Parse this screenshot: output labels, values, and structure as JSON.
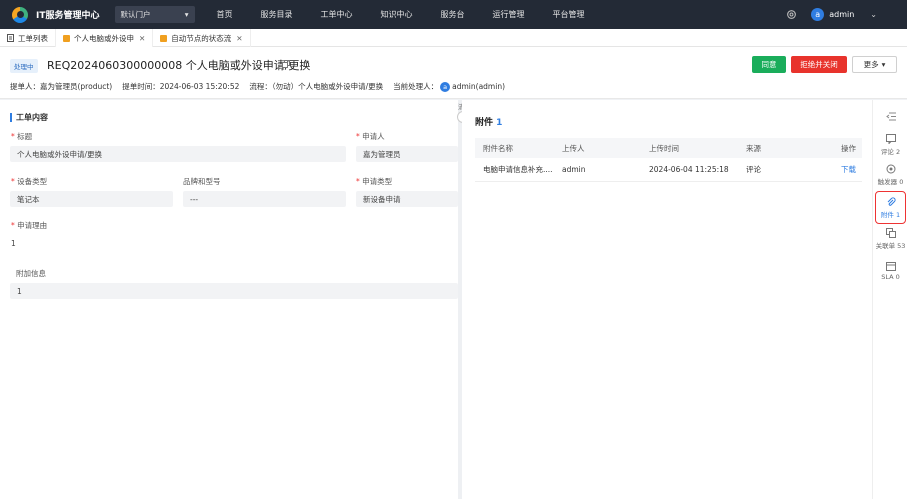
{
  "app": {
    "name": "IT服务管理中心",
    "portal": "默认门户"
  },
  "nav": [
    "首页",
    "服务目录",
    "工单中心",
    "知识中心",
    "服务台",
    "运行管理",
    "平台管理"
  ],
  "user": {
    "initial": "a",
    "name": "admin"
  },
  "tabs": [
    {
      "label": "工单列表"
    },
    {
      "label": "个人电脑或外设申"
    },
    {
      "label": "自动节点的状态流"
    }
  ],
  "ticket": {
    "status": "处理中",
    "title": "REQ2024060300000008 个人电脑或外设申请/更换",
    "actions": {
      "approve": "同意",
      "reject": "拒绝并关闭",
      "more": "更多"
    },
    "meta": {
      "submitter": "提单人：嘉为管理员(product)",
      "submit_time": "提单时间：2024-06-03 15:20:52",
      "flow": "流程：（勿动）个人电脑或外设申请/更换",
      "handler_label": "当前处理人：",
      "handler": "admin(admin)"
    }
  },
  "form": {
    "section": "工单内容",
    "fields": {
      "title_label": "标题",
      "title_value": "个人电脑或外设申请/更换",
      "applicant_label": "申请人",
      "applicant_value": "嘉为管理员",
      "device_label": "设备类型",
      "device_value": "笔记本",
      "brand_label": "品牌和型号",
      "brand_value": "---",
      "apptype_label": "申请类型",
      "apptype_value": "新设备申请",
      "reason_label": "申请理由",
      "reason_value": "1",
      "extra_label": "附加信息",
      "extra_value": "1"
    }
  },
  "splitter": {
    "label": "流"
  },
  "attachments": {
    "title": "附件",
    "count": "1",
    "columns": [
      "附件名称",
      "上传人",
      "上传时间",
      "来源",
      "操作"
    ],
    "rows": [
      {
        "name": "电脑申请信息补充....",
        "uploader": "admin",
        "time": "2024-06-04 11:25:18",
        "source": "评论",
        "action": "下载"
      }
    ]
  },
  "sidebar": [
    {
      "label": "",
      "icon": "collapse-icon"
    },
    {
      "label": "评论 2",
      "icon": "comment-icon"
    },
    {
      "label": "触发器 0",
      "icon": "trigger-icon"
    },
    {
      "label": "附件 1",
      "icon": "paperclip-icon",
      "active": true
    },
    {
      "label": "关联单 53",
      "icon": "link-icon"
    },
    {
      "label": "SLA 0",
      "icon": "sla-icon"
    }
  ],
  "colors": {
    "topbar": "#232a36",
    "accent": "#2f7de1",
    "approve": "#1aad5b",
    "reject": "#e8332c"
  }
}
